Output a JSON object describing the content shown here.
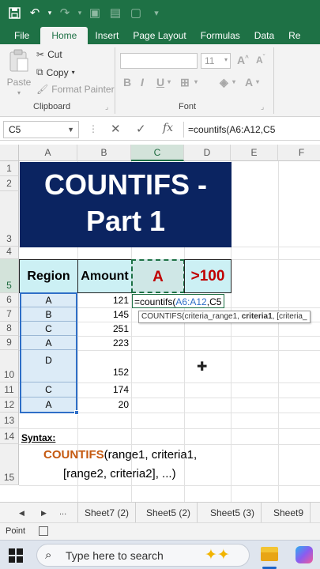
{
  "qat": {
    "icons": [
      "save-icon",
      "undo-icon",
      "dropdown-icon",
      "redo-icon",
      "camera-icon",
      "image-icon",
      "new-sheet-icon",
      "more-icon"
    ]
  },
  "ribbon_tabs": [
    "File",
    "Home",
    "Insert",
    "Page Layout",
    "Formulas",
    "Data",
    "Re"
  ],
  "active_tab": "Home",
  "clipboard": {
    "paste": "Paste",
    "cut": "Cut",
    "copy": "Copy",
    "format_painter": "Format Painter",
    "group_label": "Clipboard"
  },
  "font_group": {
    "font_size": "11",
    "group_label": "Font"
  },
  "formula_bar": {
    "name_box": "C5",
    "cancel": "✕",
    "enter": "✓",
    "fx": "fx",
    "formula": "=countifs(A6:A12,C5"
  },
  "columns": [
    "A",
    "B",
    "C",
    "D",
    "E",
    "F"
  ],
  "selected_column": "C",
  "rows": [
    "1",
    "2",
    "3",
    "4",
    "5",
    "6",
    "7",
    "8",
    "9",
    "10",
    "11",
    "12",
    "13",
    "14",
    "15"
  ],
  "title": {
    "line1": "COUNTIFS -",
    "line2": "Part 1"
  },
  "table_headers": {
    "region": "Region",
    "amount": "Amount",
    "criteria": "A",
    "threshold": ">100"
  },
  "data_rows": [
    {
      "region": "A",
      "amount": "121"
    },
    {
      "region": "B",
      "amount": "145"
    },
    {
      "region": "C",
      "amount": "251"
    },
    {
      "region": "A",
      "amount": "223"
    },
    {
      "region": "D",
      "amount": "152"
    },
    {
      "region": "C",
      "amount": "174"
    },
    {
      "region": "A",
      "amount": "20"
    }
  ],
  "editing": {
    "prefix": "=countifs(",
    "range": "A6:A12",
    "suffix": ",C5"
  },
  "tooltip": {
    "fn": "COUNTIFS(",
    "arg1": "criteria_range1, ",
    "arg2": "criteria1",
    "rest": ", [criteria_"
  },
  "syntax": {
    "label": "Syntax:",
    "fn": "COUNTIFS",
    "line1_rest": "(range1, criteria1,",
    "line2": "[range2, criteria2], ...)"
  },
  "sheet_tabs": [
    "Sheet7 (2)",
    "Sheet5 (2)",
    "Sheet5 (3)",
    "Sheet9"
  ],
  "sheet_nav": {
    "prev": "◀",
    "next": "▶",
    "more": "..."
  },
  "status": {
    "mode": "Point"
  },
  "taskbar": {
    "search_placeholder": "Type here to search"
  },
  "colors": {
    "excel_green": "#1e7145",
    "title_bg": "#0b2461",
    "header_bg": "#ccf0f4",
    "red_text": "#c00000",
    "syntax_fn": "#c55a11"
  }
}
